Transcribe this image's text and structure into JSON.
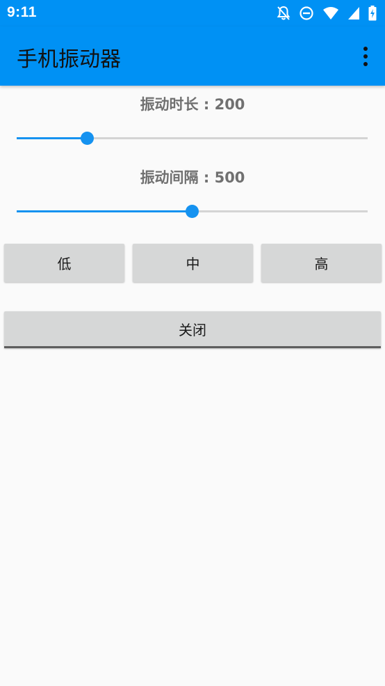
{
  "status_bar": {
    "time": "9:11",
    "icons": [
      "notifications-off-icon",
      "do-not-disturb-icon",
      "wifi-icon",
      "signal-icon",
      "battery-charging-icon"
    ]
  },
  "app_bar": {
    "title": "手机振动器",
    "menu_icon": "more-vert-icon"
  },
  "vibration_duration": {
    "label": "振动时长 : 200",
    "value": 200,
    "fraction": 0.2
  },
  "vibration_interval": {
    "label": "振动间隔 : 500",
    "value": 500,
    "fraction": 0.5
  },
  "level_buttons": {
    "low": "低",
    "medium": "中",
    "high": "高"
  },
  "close_button": "关闭",
  "colors": {
    "primary": "#0091f4",
    "accent": "#1592f0",
    "button": "#d6d7d7",
    "background": "#fafafa"
  }
}
